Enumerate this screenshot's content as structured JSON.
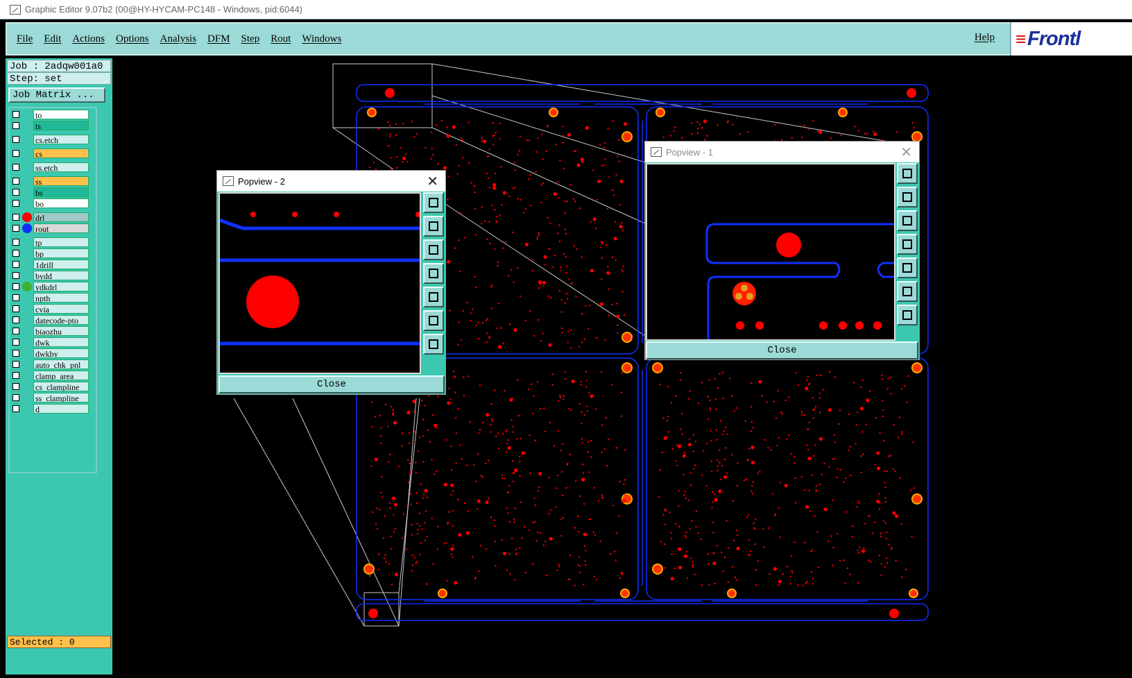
{
  "window": {
    "title": "Graphic Editor 9.07b2 (00@HY-HYCAM-PC148 - Windows, pid:6044)"
  },
  "menu": {
    "items": [
      "File",
      "Edit",
      "Actions",
      "Options",
      "Analysis",
      "DFM",
      "Step",
      "Rout",
      "Windows"
    ],
    "help": "Help",
    "logo": "Frontl"
  },
  "info": {
    "job": "Job : 2adqw001a0",
    "step": "Step: set",
    "job_matrix": "Job Matrix ..."
  },
  "layers": [
    {
      "name": "to",
      "color": "#ffffff",
      "dot": ""
    },
    {
      "name": "ts",
      "color": "#20b898",
      "dot": ""
    },
    {
      "name": "cs.etch",
      "color": "#cfeeee",
      "dot": ""
    },
    {
      "name": "cs",
      "color": "#ffc04c",
      "dot": ""
    },
    {
      "name": "ss.etch",
      "color": "#cfeeee",
      "dot": ""
    },
    {
      "name": "ss",
      "color": "#ffc04c",
      "dot": ""
    },
    {
      "name": "bs",
      "color": "#20b898",
      "dot": ""
    },
    {
      "name": "bo",
      "color": "#ffffff",
      "dot": ""
    },
    {
      "name": "drl",
      "color": "#a0c8c8",
      "dot": "#ff0000"
    },
    {
      "name": "rout",
      "color": "#d8d8d8",
      "dot": "#1030ff"
    },
    {
      "name": "tp",
      "color": "#cfeeee",
      "dot": ""
    },
    {
      "name": "bp",
      "color": "#cfeeee",
      "dot": ""
    },
    {
      "name": "1drill",
      "color": "#cfeeee",
      "dot": ""
    },
    {
      "name": "bydd",
      "color": "#cfeeee",
      "dot": ""
    },
    {
      "name": "ydkdrl",
      "color": "#cfeeee",
      "dot": "#40b030"
    },
    {
      "name": "npth",
      "color": "#cfeeee",
      "dot": ""
    },
    {
      "name": "cvia",
      "color": "#cfeeee",
      "dot": ""
    },
    {
      "name": "datecode-pto",
      "color": "#cfeeee",
      "dot": ""
    },
    {
      "name": "biaozhu",
      "color": "#cfeeee",
      "dot": ""
    },
    {
      "name": "dwk",
      "color": "#cfeeee",
      "dot": ""
    },
    {
      "name": "dwkby",
      "color": "#cfeeee",
      "dot": ""
    },
    {
      "name": "auto_chk_pnl",
      "color": "#cfeeee",
      "dot": ""
    },
    {
      "name": "clamp_area",
      "color": "#cfeeee",
      "dot": ""
    },
    {
      "name": "cs_clampline",
      "color": "#cfeeee",
      "dot": ""
    },
    {
      "name": "ss_clampline",
      "color": "#cfeeee",
      "dot": ""
    },
    {
      "name": "d",
      "color": "#cfeeee",
      "dot": ""
    }
  ],
  "status": {
    "selected": "Selected : 0"
  },
  "popview1": {
    "title": "Popview - 1",
    "close": "Close"
  },
  "popview2": {
    "title": "Popview - 2",
    "close": "Close"
  },
  "colors": {
    "pad": "#ff0000",
    "rout": "#1030ff",
    "accent": "#3cc8b0",
    "button": "#9bdad6"
  }
}
